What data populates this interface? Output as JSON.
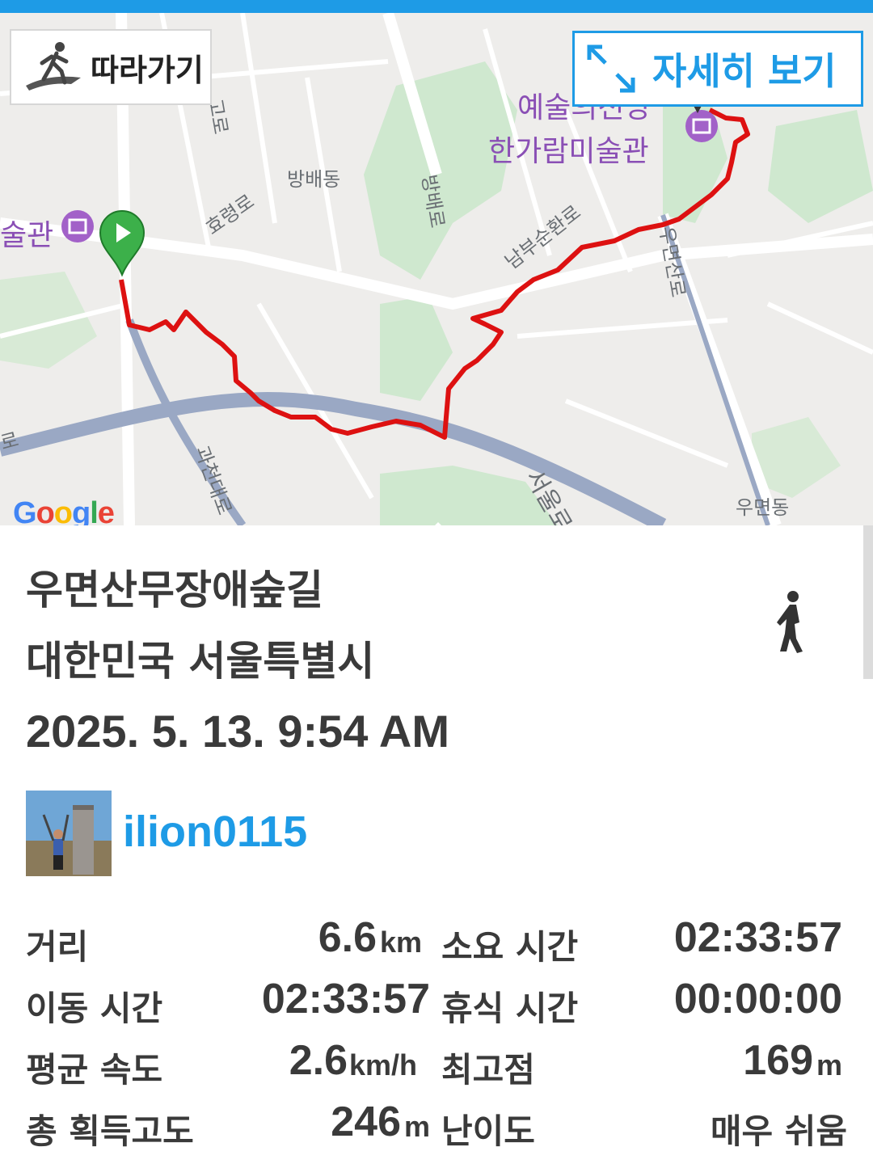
{
  "map": {
    "follow_label": "따라가기",
    "detail_label": "자세히 보기",
    "google_logo": "Google",
    "labels": {
      "yesuluijeondang": "예술의전당",
      "hangaram": "한가람미술관",
      "bangbaedong": "방배동",
      "bangbaero": "방배로",
      "hyoryeongro": "효령로",
      "nambusunhwanro": "남부순환로",
      "umyeonsanro": "우면산로",
      "gwacheondaero": "과천대로",
      "seoulro": "서울로",
      "umyeondong": "우면동",
      "misulgwan": "술관",
      "ro_left": "로",
      "goro": "고로"
    },
    "colors": {
      "route": "#dd1111",
      "accent": "#1e9be6",
      "start_marker": "#3cb04a",
      "poi": "#8a4fb5"
    }
  },
  "trip": {
    "title": "우면산무장애숲길",
    "location": "대한민국 서울특별시",
    "datetime": "2025. 5. 13. 9:54 AM",
    "activity_icon": "walking-person-icon",
    "username": "ilion0115"
  },
  "stats": {
    "distance_label": "거리",
    "distance_value": "6.6",
    "distance_unit": "km",
    "total_time_label": "소요 시간",
    "total_time_value": "02:33:57",
    "moving_time_label": "이동 시간",
    "moving_time_value": "02:33:57",
    "rest_time_label": "휴식 시간",
    "rest_time_value": "00:00:00",
    "avg_speed_label": "평균 속도",
    "avg_speed_value": "2.6",
    "avg_speed_unit": "km/h",
    "max_alt_label": "최고점",
    "max_alt_value": "169",
    "max_alt_unit": "m",
    "elev_gain_label": "총 획득고도",
    "elev_gain_value": "246",
    "elev_gain_unit": "m",
    "difficulty_label": "난이도",
    "difficulty_value": "매우 쉬움"
  }
}
